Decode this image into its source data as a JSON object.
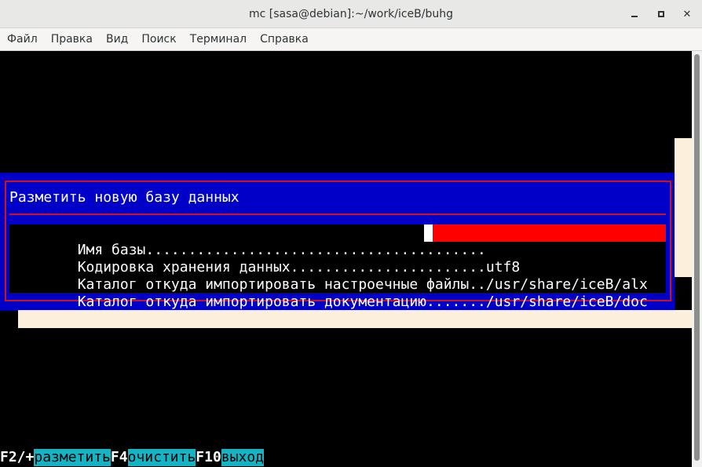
{
  "window": {
    "title": "mc [sasa@debian]:~/work/iceB/buhg",
    "minimize_icon": "minimize-icon",
    "maximize_icon": "maximize-icon",
    "close_label": "✕"
  },
  "menu": {
    "items": [
      "Файл",
      "Правка",
      "Вид",
      "Поиск",
      "Терминал",
      "Справка"
    ]
  },
  "dialog": {
    "title": "Разметить новую базу данных",
    "fields": [
      {
        "label": "Имя базы........................................",
        "value": ""
      },
      {
        "label": "Кодировка хранения данных.......................",
        "value": "utf8"
      },
      {
        "label": "Каталог откуда импортировать настроечные файлы..",
        "value": "/usr/share/iceB/alx"
      },
      {
        "label": "Каталог откуда импортировать документацию.......",
        "value": "/usr/share/iceB/doc"
      }
    ]
  },
  "keybar": [
    {
      "key": "F2/+",
      "action": "разметить"
    },
    {
      "key": "F4",
      "action": "очистить"
    },
    {
      "key": "F10",
      "action": "выход"
    }
  ],
  "colors": {
    "dialog_bg": "#0000c8",
    "frame": "#d01018",
    "input": "#ff0000",
    "shadow": "#fcefdc",
    "key_action_bg": "#14b4c4"
  }
}
